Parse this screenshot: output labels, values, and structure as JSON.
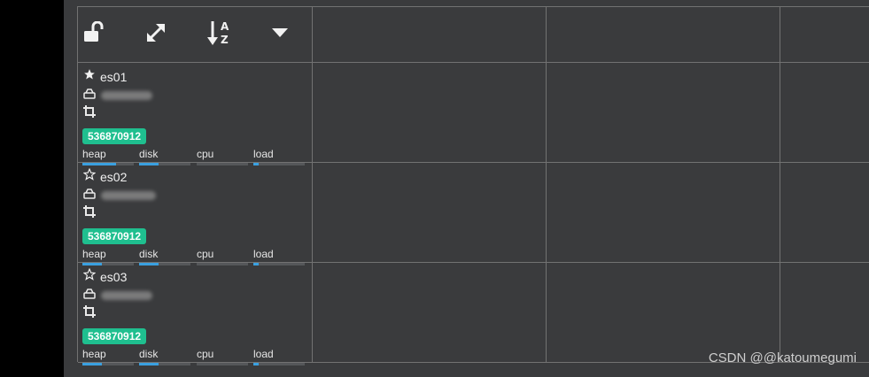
{
  "toolbar": {
    "icons": [
      "unlock-icon",
      "expand-icon",
      "sort-alpha-icon",
      "caret-down-icon"
    ]
  },
  "nodes": [
    {
      "name": "es01",
      "starred": true,
      "badge": "536870912",
      "metrics": [
        {
          "label": "heap",
          "fraction": 0.65
        },
        {
          "label": "disk",
          "fraction": 0.38
        },
        {
          "label": "cpu",
          "fraction": 0.0
        },
        {
          "label": "load",
          "fraction": 0.1
        }
      ]
    },
    {
      "name": "es02",
      "starred": false,
      "badge": "536870912",
      "metrics": [
        {
          "label": "heap",
          "fraction": 0.38
        },
        {
          "label": "disk",
          "fraction": 0.38
        },
        {
          "label": "cpu",
          "fraction": 0.0
        },
        {
          "label": "load",
          "fraction": 0.1
        }
      ]
    },
    {
      "name": "es03",
      "starred": false,
      "badge": "536870912",
      "metrics": [
        {
          "label": "heap",
          "fraction": 0.38
        },
        {
          "label": "disk",
          "fraction": 0.38
        },
        {
          "label": "cpu",
          "fraction": 0.0
        },
        {
          "label": "load",
          "fraction": 0.1
        }
      ]
    }
  ],
  "watermark": "CSDN @@katoumegumi",
  "colors": {
    "background": "#3a3b3d",
    "gridline": "#727272",
    "badge": "#1fbf8f",
    "bar_fill": "#3aa0e0"
  }
}
